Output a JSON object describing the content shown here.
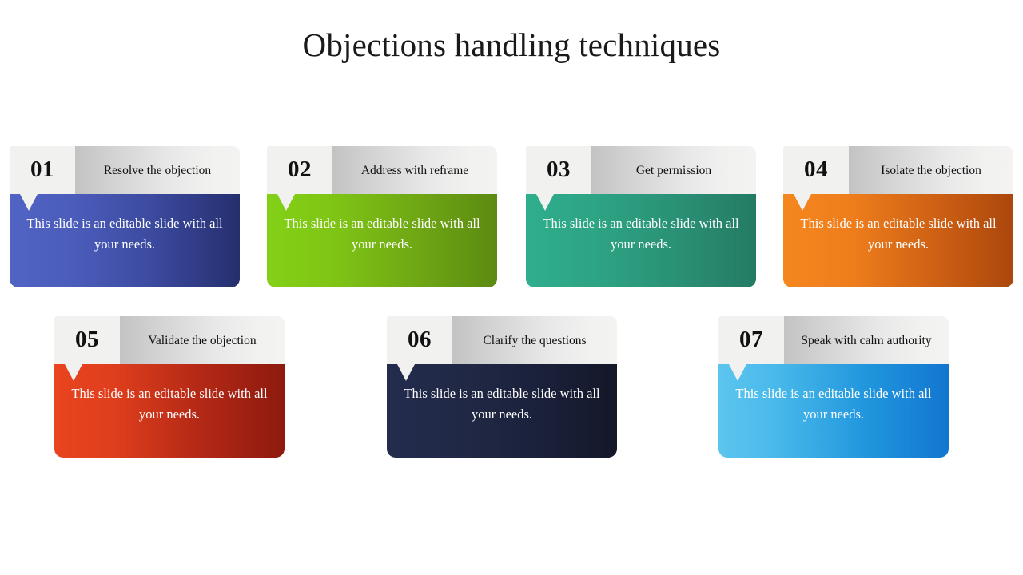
{
  "slide": {
    "title": "Objections handling techniques",
    "background_color": "#ffffff",
    "body_text": "This slide is an editable slide with all your needs."
  },
  "cards": [
    {
      "number": "01",
      "heading": "Resolve the objection",
      "body": "This slide is an editable slide with all your needs.",
      "color": "#3c4a9f",
      "gradient_from": "#5164c4",
      "gradient_to": "#252f6e"
    },
    {
      "number": "02",
      "heading": "Address with reframe",
      "body": "This slide is an editable slide with all your needs.",
      "color": "#7ec415",
      "gradient_from": "#84d017",
      "gradient_to": "#5c8a12"
    },
    {
      "number": "03",
      "heading": "Get permission",
      "body": "This slide is an editable slide with all your needs.",
      "color": "#2da383",
      "gradient_from": "#2fae8d",
      "gradient_to": "#247b64"
    },
    {
      "number": "04",
      "heading": "Isolate the objection",
      "body": "This slide is an editable slide with all your needs.",
      "color": "#ee7d1c",
      "gradient_from": "#f5871f",
      "gradient_to": "#ab470c"
    },
    {
      "number": "05",
      "heading": "Validate the objection",
      "body": "This slide is an editable slide with all your needs.",
      "color": "#df3e1d",
      "gradient_from": "#e8441f",
      "gradient_to": "#8d1a0e"
    },
    {
      "number": "06",
      "heading": "Clarify the questions",
      "body": "This slide is an editable slide with all your needs.",
      "color": "#202845",
      "gradient_from": "#232c4d",
      "gradient_to": "#141728"
    },
    {
      "number": "07",
      "heading": "Speak with calm authority",
      "body": "This slide is an editable slide with all your needs.",
      "color": "#48b8ea",
      "gradient_from": "#5cc5ef",
      "gradient_to": "#1276cf"
    }
  ]
}
